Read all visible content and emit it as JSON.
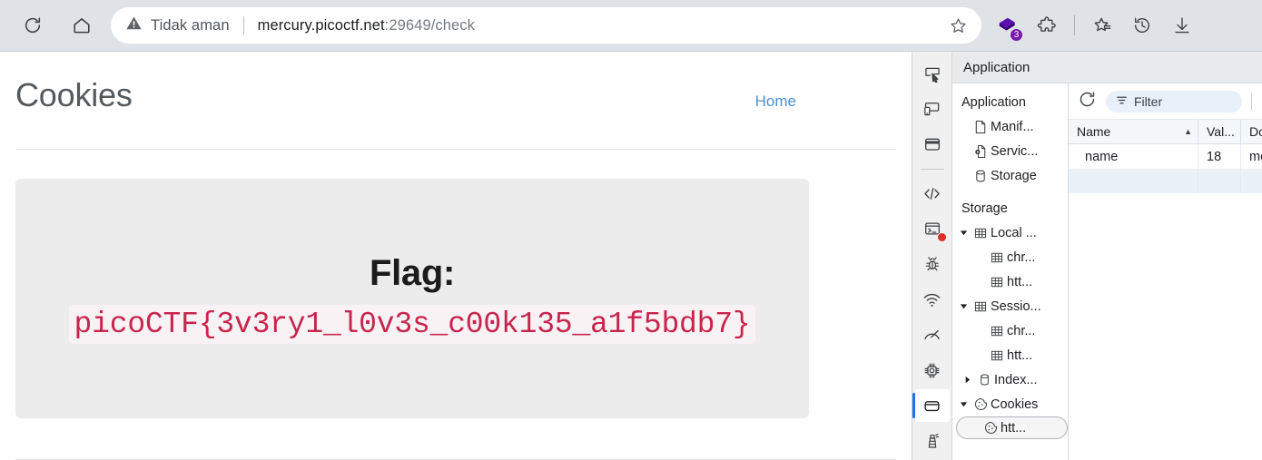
{
  "browser": {
    "nav": {
      "reload_title": "Reload",
      "home_title": "Home"
    },
    "omnibox": {
      "security_label": "Tidak aman",
      "url_host": "mercury.picoctf.net",
      "url_rest": ":29649/check",
      "bookmark_title": "Add this page to favorites"
    },
    "actions": {
      "collections_badge": "3",
      "collections_title": "Collections",
      "extensions_title": "Extensions",
      "favorites_title": "Favorites",
      "history_title": "History",
      "downloads_title": "Downloads"
    }
  },
  "page": {
    "title": "Cookies",
    "home_link": "Home",
    "flag_label": "Flag:",
    "flag_value": "picoCTF{3v3ry1_l0v3s_c00k135_a1f5bdb7}"
  },
  "devtools": {
    "panel_tab": "Application",
    "activity_bar": [
      {
        "name": "inspect-element-icon"
      },
      {
        "name": "device-toolbar-icon"
      },
      {
        "name": "elements-panel-icon"
      },
      {
        "name": "sources-panel-icon"
      },
      {
        "name": "console-panel-icon"
      },
      {
        "name": "issues-panel-icon"
      },
      {
        "name": "network-conditions-icon"
      },
      {
        "name": "performance-panel-icon"
      },
      {
        "name": "memory-panel-icon"
      },
      {
        "name": "application-panel-icon"
      },
      {
        "name": "lighthouse-panel-icon"
      }
    ],
    "sidebar": {
      "application_section": "Application",
      "application_items": [
        {
          "label": "Manif...",
          "icon": "manifest-icon"
        },
        {
          "label": "Servic...",
          "icon": "service-worker-icon"
        },
        {
          "label": "Storage",
          "icon": "storage-icon"
        }
      ],
      "storage_section": "Storage",
      "storage_items": [
        {
          "label": "Local ...",
          "icon": "table-icon",
          "indent": 0,
          "arrow": "expanded"
        },
        {
          "label": "chr...",
          "icon": "table-icon",
          "indent": 1,
          "arrow": "none"
        },
        {
          "label": "htt...",
          "icon": "table-icon",
          "indent": 1,
          "arrow": "none"
        },
        {
          "label": "Sessio...",
          "icon": "table-icon",
          "indent": 0,
          "arrow": "expanded"
        },
        {
          "label": "chr...",
          "icon": "table-icon",
          "indent": 1,
          "arrow": "none"
        },
        {
          "label": "htt...",
          "icon": "table-icon",
          "indent": 1,
          "arrow": "none"
        },
        {
          "label": "Index...",
          "icon": "database-icon",
          "indent": 0,
          "arrow": "collapsed"
        },
        {
          "label": "Cookies",
          "icon": "cookie-icon",
          "indent": 0,
          "arrow": "expanded"
        },
        {
          "label": "htt...",
          "icon": "cookie-icon",
          "indent": 1,
          "arrow": "none",
          "selected": true
        }
      ]
    },
    "toolbar": {
      "refresh_title": "Refresh",
      "filter_placeholder": "Filter"
    },
    "table": {
      "columns": [
        {
          "label": "Name",
          "sorted": "asc"
        },
        {
          "label": "Val...",
          "sorted": ""
        },
        {
          "label": "Do...",
          "sorted": ""
        }
      ],
      "rows": [
        {
          "name": "name",
          "value": "18",
          "domain": "me..."
        }
      ]
    }
  },
  "colors": {
    "accent_blue": "#1a73e8",
    "link_blue": "#4a90d9",
    "flag_crimson": "#c7254e",
    "flag_bg": "#f9f2f4",
    "collections_purple": "#7719aa",
    "error_red": "#d93025"
  }
}
